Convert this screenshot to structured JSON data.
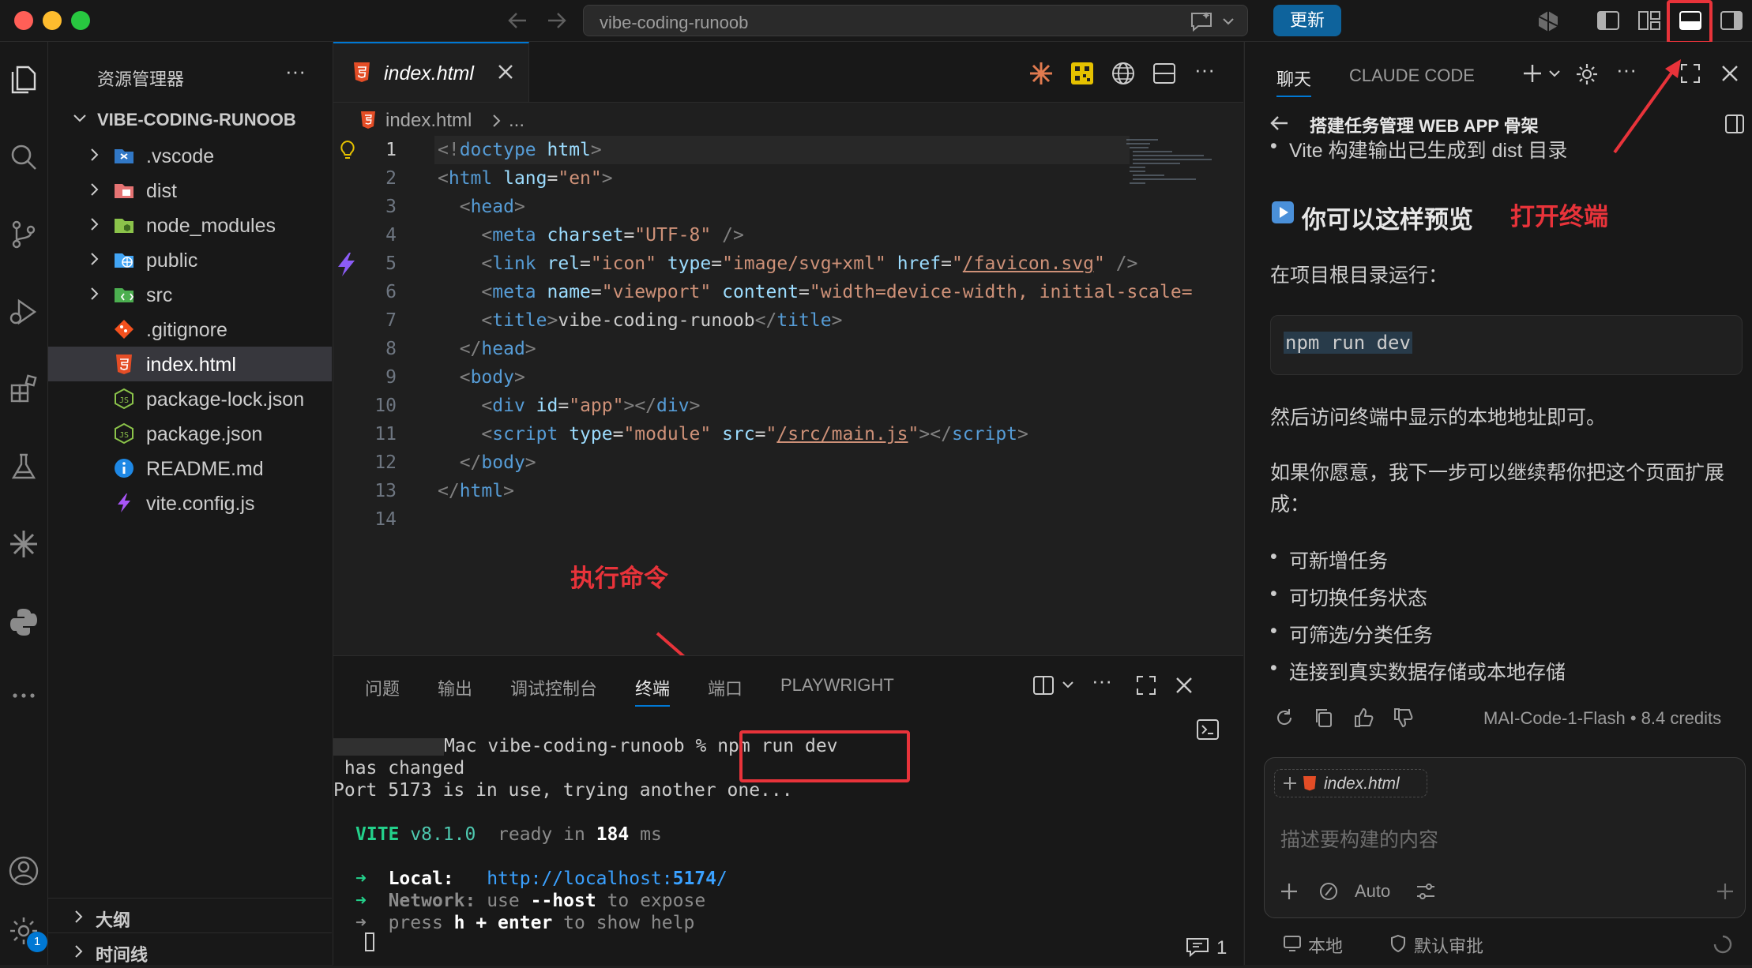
{
  "titlebar": {
    "search_text": "vibe-coding-runoob",
    "update_label": "更新"
  },
  "sidebar": {
    "title": "资源管理器",
    "root": "VIBE-CODING-RUNOOB",
    "items": [
      {
        "label": ".vscode",
        "folder": true
      },
      {
        "label": "dist",
        "folder": true
      },
      {
        "label": "node_modules",
        "folder": true
      },
      {
        "label": "public",
        "folder": true
      },
      {
        "label": "src",
        "folder": true
      },
      {
        "label": ".gitignore",
        "folder": false
      },
      {
        "label": "index.html",
        "folder": false,
        "active": true
      },
      {
        "label": "package-lock.json",
        "folder": false
      },
      {
        "label": "package.json",
        "folder": false
      },
      {
        "label": "README.md",
        "folder": false
      },
      {
        "label": "vite.config.js",
        "folder": false
      }
    ],
    "outline_label": "大纲",
    "timeline_label": "时间线",
    "settings_badge": "1"
  },
  "editor": {
    "tab_label": "index.html",
    "breadcrumb_file": "index.html",
    "breadcrumb_more": "...",
    "line_numbers": [
      "1",
      "2",
      "3",
      "4",
      "5",
      "6",
      "7",
      "8",
      "9",
      "10",
      "11",
      "12",
      "13",
      "14"
    ],
    "annotation": "执行命令"
  },
  "panel": {
    "tabs": [
      "问题",
      "输出",
      "调试控制台",
      "终端",
      "端口",
      "PLAYWRIGHT"
    ],
    "active_tab": "终端",
    "terminal": {
      "prompt_host": "Mac vibe-coding-runoob %",
      "command": "npm run dev",
      "line2": " has changed",
      "line3": "Port 5173 is in use, trying another one...",
      "vite_name": "VITE",
      "vite_version": "v8.1.0",
      "ready_text": "ready in",
      "ready_ms": "184",
      "ready_unit": "ms",
      "local_label": "Local:",
      "local_url_prefix": "http://localhost:",
      "local_port": "5174",
      "local_url_suffix": "/",
      "network_label": "Network:",
      "network_text_1": "use",
      "network_text_host": "--host",
      "network_text_2": "to expose",
      "help_text_1": "press",
      "help_key": "h + enter",
      "help_text_2": "to show help"
    },
    "chat_count": "1"
  },
  "chat": {
    "tab_chat": "聊天",
    "tab_claude": "CLAUDE CODE",
    "header_title": "搭建任务管理 WEB APP 骨架",
    "line_vite": "Vite 构建输出已生成到 dist 目录",
    "preview_heading": "你可以这样预览",
    "annotation_terminal": "打开终端",
    "run_in_root": "在项目根目录运行：",
    "code_cmd": "npm run dev",
    "then_visit": "然后访问终端中显示的本地地址即可。",
    "offer": "如果你愿意，我下一步可以继续帮你把这个页面扩展成：",
    "bullets": [
      "可新增任务",
      "可切换任务状态",
      "可筛选/分类任务",
      "连接到真实数据存储或本地存储"
    ],
    "model_info": "MAI-Code-1-Flash • 8.4 credits",
    "context_file": "index.html",
    "input_placeholder": "描述要构建的内容",
    "auto_label": "Auto",
    "footer_local": "本地",
    "footer_approval": "默认审批"
  },
  "colors": {
    "accent": "#0078d4",
    "annotation_red": "#e8333a",
    "html_icon": "#e44d26"
  }
}
